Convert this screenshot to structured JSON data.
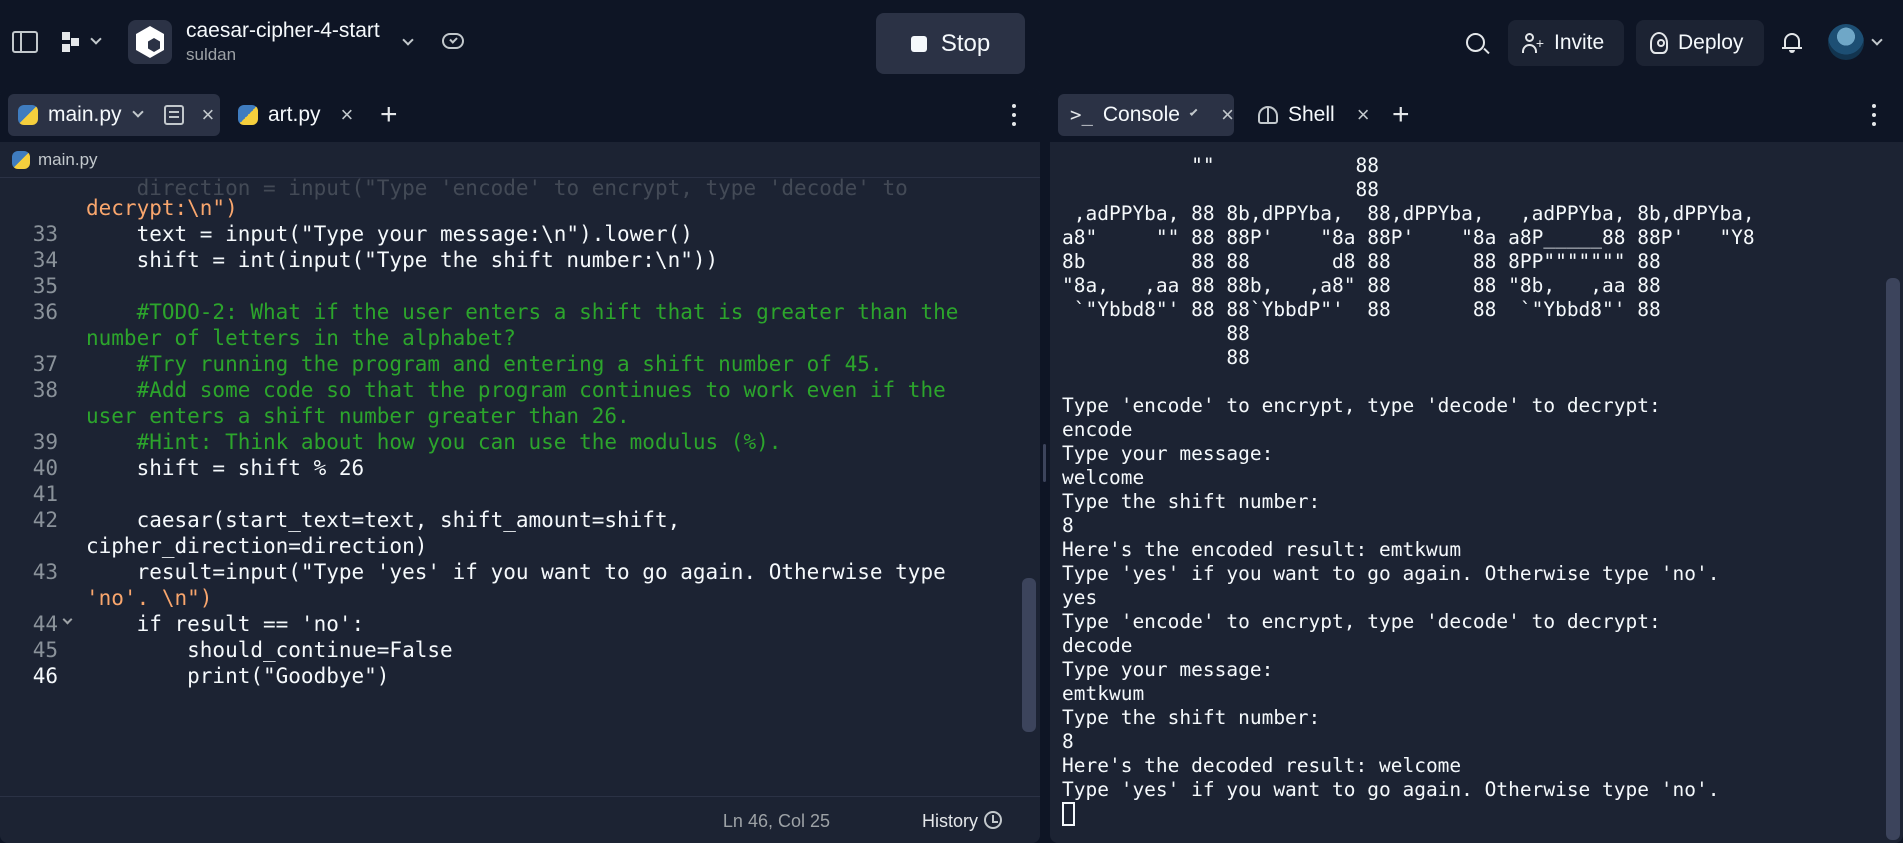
{
  "header": {
    "repl_name": "caesar-cipher-4-start",
    "owner": "suldan",
    "stop_label": "Stop",
    "invite_label": "Invite",
    "deploy_label": "Deploy"
  },
  "editor": {
    "tabs": [
      {
        "label": "main.py"
      },
      {
        "label": "art.py"
      }
    ],
    "breadcrumb": "main.py",
    "lines": [
      {
        "ln": "",
        "text": "decrypt:\\n\")"
      },
      {
        "ln": "33",
        "text": "    text = input(\"Type your message:\\n\").lower()"
      },
      {
        "ln": "34",
        "text": "    shift = int(input(\"Type the shift number:\\n\"))"
      },
      {
        "ln": "35",
        "text": ""
      },
      {
        "ln": "36",
        "text": "    #TODO-2: What if the user enters a shift that is greater than the"
      },
      {
        "ln": "",
        "text": "number of letters in the alphabet?"
      },
      {
        "ln": "37",
        "text": "    #Try running the program and entering a shift number of 45."
      },
      {
        "ln": "38",
        "text": "    #Add some code so that the program continues to work even if the"
      },
      {
        "ln": "",
        "text": "user enters a shift number greater than 26."
      },
      {
        "ln": "39",
        "text": "    #Hint: Think about how you can use the modulus (%)."
      },
      {
        "ln": "40",
        "text": "    shift = shift % 26"
      },
      {
        "ln": "41",
        "text": ""
      },
      {
        "ln": "42",
        "text": "    caesar(start_text=text, shift_amount=shift,"
      },
      {
        "ln": "",
        "text": "cipher_direction=direction)"
      },
      {
        "ln": "43",
        "text": "    result=input(\"Type 'yes' if you want to go again. Otherwise type"
      },
      {
        "ln": "",
        "text": "'no'. \\n\")"
      },
      {
        "ln": "44",
        "text": "    if result == 'no':"
      },
      {
        "ln": "45",
        "text": "        should_continue=False"
      },
      {
        "ln": "46",
        "text": "        print(\"Goodbye\")"
      }
    ],
    "status": {
      "cursor": "Ln 46, Col 25",
      "history_label": "History"
    }
  },
  "console": {
    "tabs": [
      {
        "label": "Console"
      },
      {
        "label": "Shell"
      }
    ],
    "output": "           \"\"            88\n                         88\n ,adPPYba, 88 8b,dPPYba,  88,dPPYba,   ,adPPYba, 8b,dPPYba,\na8\"     \"\" 88 88P'    \"8a 88P'    \"8a a8P_____88 88P'   \"Y8\n8b         88 88       d8 88       88 8PP\"\"\"\"\"\"\" 88\n\"8a,   ,aa 88 88b,   ,a8\" 88       88 \"8b,   ,aa 88\n `\"Ybbd8\"' 88 88`YbbdP\"'  88       88  `\"Ybbd8\"' 88\n              88\n              88\n\nType 'encode' to encrypt, type 'decode' to decrypt:\nencode\nType your message:\nwelcome\nType the shift number:\n8\nHere's the encoded result: emtkwum\nType 'yes' if you want to go again. Otherwise type 'no'.\nyes\nType 'encode' to encrypt, type 'decode' to decrypt:\ndecode\nType your message:\nemtkwum\nType the shift number:\n8\nHere's the decoded result: welcome\nType 'yes' if you want to go again. Otherwise type 'no'."
  }
}
